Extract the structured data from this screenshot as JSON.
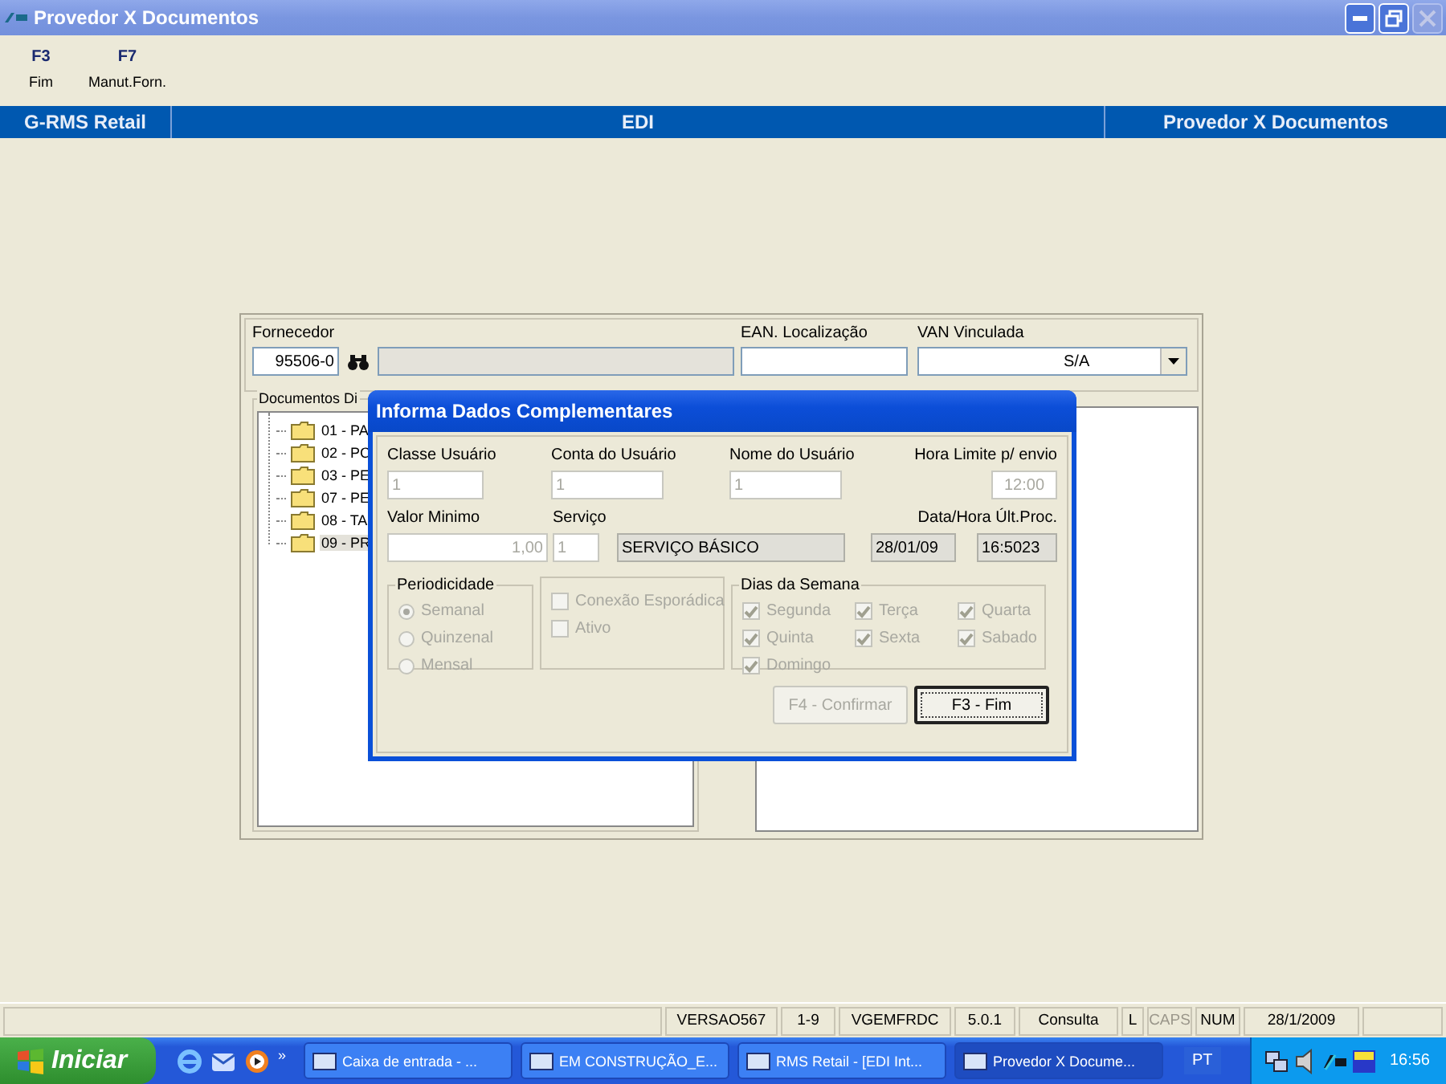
{
  "window": {
    "title": "Provedor X Documentos"
  },
  "toolbar": [
    {
      "key": "F3",
      "label": "Fim"
    },
    {
      "key": "F7",
      "label": "Manut.Forn."
    }
  ],
  "header": [
    "G-RMS Retail",
    "EDI",
    "Provedor X Documentos"
  ],
  "form": {
    "fornecedor_label": "Fornecedor",
    "fornecedor_code": "95506-0",
    "ean_label": "EAN. Localização",
    "van_label": "VAN Vinculada",
    "van_value": "S/A",
    "documentos_label": "Documentos Di",
    "tree": [
      {
        "label": "01 - PA",
        "selected": false
      },
      {
        "label": "02 - PC",
        "selected": false
      },
      {
        "label": "03 - PE",
        "selected": false
      },
      {
        "label": "07 - PE",
        "selected": false
      },
      {
        "label": "08 - TA",
        "selected": false
      },
      {
        "label": "09 - PR",
        "selected": true
      }
    ]
  },
  "dialog": {
    "title": "Informa Dados Complementares",
    "classe_usuario": {
      "label": "Classe Usuário",
      "value": "1"
    },
    "conta_usuario": {
      "label": "Conta do Usuário",
      "value": "1"
    },
    "nome_usuario": {
      "label": "Nome do Usuário",
      "value": "1"
    },
    "hora_limite": {
      "label": "Hora Limite p/ envio",
      "value": "12:00"
    },
    "valor_minimo": {
      "label": "Valor Minimo",
      "value": "1,00"
    },
    "servico": {
      "label": "Serviço",
      "code": "1",
      "description": "SERVIÇO BÁSICO"
    },
    "data_hora": {
      "label": "Data/Hora Últ.Proc.",
      "date": "28/01/09",
      "time": "16:5023"
    },
    "periodicidade": {
      "title": "Periodicidade",
      "options": [
        {
          "label": "Semanal",
          "selected": true
        },
        {
          "label": "Quinzenal",
          "selected": false
        },
        {
          "label": "Mensal",
          "selected": false
        }
      ]
    },
    "flags": [
      {
        "label": "Conexão Esporádica",
        "checked": false
      },
      {
        "label": "Ativo",
        "checked": false
      }
    ],
    "dias": {
      "title": "Dias da Semana",
      "days": [
        {
          "label": "Segunda",
          "checked": true
        },
        {
          "label": "Terça",
          "checked": true
        },
        {
          "label": "Quarta",
          "checked": true
        },
        {
          "label": "Quinta",
          "checked": true
        },
        {
          "label": "Sexta",
          "checked": true
        },
        {
          "label": "Sabado",
          "checked": true
        },
        {
          "label": "Domingo",
          "checked": true
        }
      ]
    },
    "buttons": [
      {
        "label": "F4 - Confirmar",
        "disabled": true
      },
      {
        "label": "F3 - Fim",
        "disabled": false
      }
    ]
  },
  "status_bar": [
    {
      "text": "VERSAO567",
      "disabled": false
    },
    {
      "text": "1-9",
      "disabled": false
    },
    {
      "text": "VGEMFRDC",
      "disabled": false
    },
    {
      "text": "5.0.1",
      "disabled": false
    },
    {
      "text": "Consulta",
      "disabled": false
    },
    {
      "text": "L",
      "disabled": false
    },
    {
      "text": "CAPS",
      "disabled": true
    },
    {
      "text": "NUM",
      "disabled": false
    },
    {
      "text": "28/1/2009",
      "disabled": false
    }
  ],
  "taskbar": {
    "start": "Iniciar",
    "more": "»",
    "tasks": [
      {
        "label": "Caixa de entrada - ...",
        "selected": false
      },
      {
        "label": "EM CONSTRUÇÃO_E...",
        "selected": false
      },
      {
        "label": "RMS Retail - [EDI Int...",
        "selected": false
      },
      {
        "label": "Provedor X Docume...",
        "selected": true
      }
    ],
    "language": "PT",
    "clock": "16:56"
  }
}
